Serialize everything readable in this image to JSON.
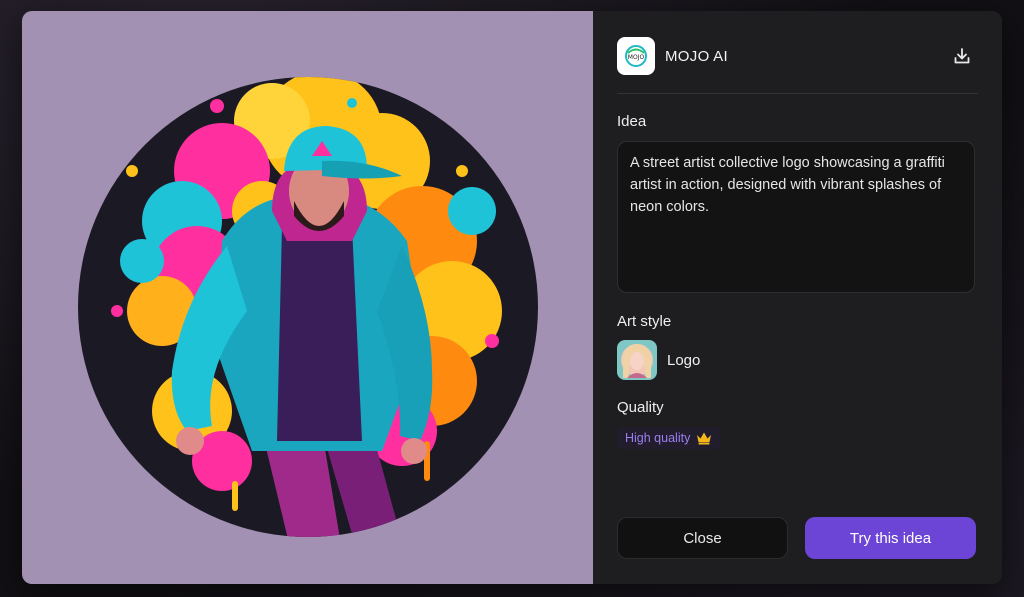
{
  "app": {
    "name": "MOJO AI",
    "logo_text": "MOJO"
  },
  "image": {
    "background_color": "#a391b4",
    "accent_colors": [
      "#1fc3d8",
      "#ff2fa0",
      "#ffc21a",
      "#ff8a10",
      "#6a2aa8"
    ]
  },
  "idea": {
    "label": "Idea",
    "text": "A street artist collective logo showcasing a graffiti artist in action, designed with vibrant splashes of neon colors."
  },
  "art_style": {
    "label": "Art style",
    "name": "Logo"
  },
  "quality": {
    "label": "Quality",
    "badge": "High quality",
    "badge_icon": "crown-icon"
  },
  "actions": {
    "close_label": "Close",
    "try_label": "Try this idea",
    "download_icon": "download-icon"
  },
  "colors": {
    "accent": "#6c45d6",
    "panel": "#1e1e20",
    "quality_text": "#9a7ff0"
  }
}
